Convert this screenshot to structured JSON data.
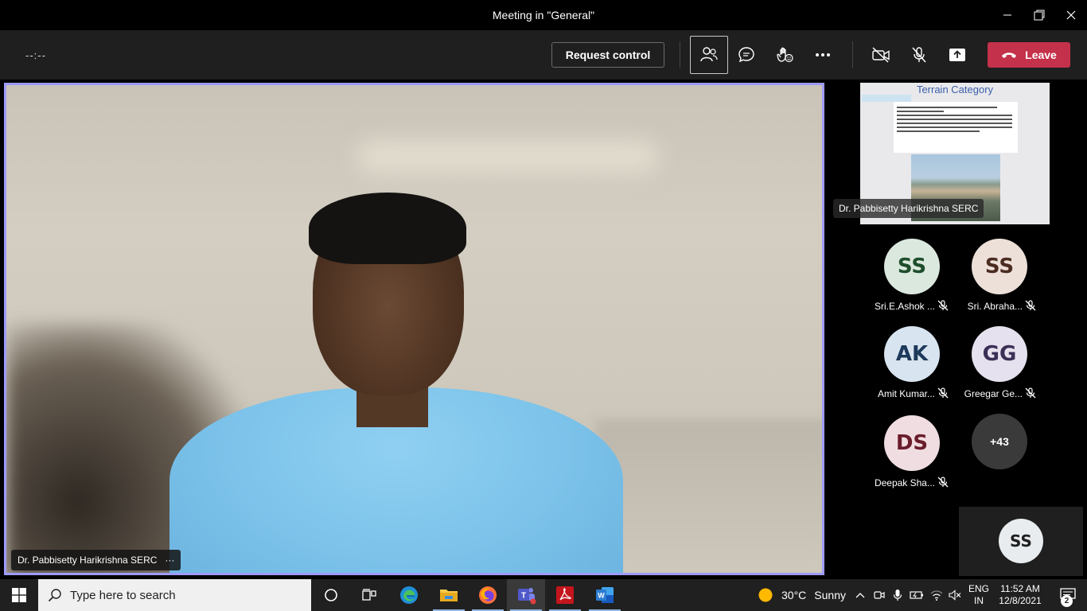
{
  "window": {
    "title": "Meeting in \"General\""
  },
  "toolbar": {
    "timer": "--:--",
    "request_control_label": "Request control",
    "leave_label": "Leave",
    "icons": [
      "participants-icon",
      "chat-icon",
      "raise-hand-icon",
      "more-options-icon",
      "camera-off-icon",
      "mic-off-icon",
      "share-tray-icon",
      "phone-hangup-icon"
    ]
  },
  "main_video": {
    "participant_name": "Dr. Pabbisetty Harikrishna SERC",
    "more_label": "···"
  },
  "shared_content": {
    "slide_title": "Terrain Category",
    "presenter_name": "Dr. Pabbisetty Harikrishna SERC"
  },
  "participants": [
    {
      "initials": "SS",
      "name": "Sri.E.Ashok ...",
      "muted": true,
      "bg": "#dbe8de",
      "fg": "#1e4d2b"
    },
    {
      "initials": "SS",
      "name": "Sri. Abraha...",
      "muted": true,
      "bg": "#ece0d9",
      "fg": "#4b2c20"
    },
    {
      "initials": "AK",
      "name": "Amit Kumar...",
      "muted": true,
      "bg": "#d8e4f0",
      "fg": "#1d3a5b"
    },
    {
      "initials": "GG",
      "name": "Greegar Ge...",
      "muted": true,
      "bg": "#e6e1ee",
      "fg": "#3b2f57"
    },
    {
      "initials": "DS",
      "name": "Deepak Sha...",
      "muted": true,
      "bg": "#f0dde1",
      "fg": "#6a1d2c"
    }
  ],
  "overflow_count": "+43",
  "self_view": {
    "initials": "SS"
  },
  "taskbar": {
    "search_placeholder": "Type here to search",
    "apps": [
      "cortana-icon",
      "task-view-icon",
      "edge-icon",
      "file-explorer-icon",
      "firefox-icon",
      "teams-icon",
      "acrobat-icon",
      "word-icon"
    ],
    "weather_temp": "30°C",
    "weather_desc": "Sunny",
    "lang_line1": "ENG",
    "lang_line2": "IN",
    "time": "11:52 AM",
    "date": "12/8/2021",
    "notification_count": "2"
  },
  "colors": {
    "accent_border": "#9e9bff",
    "leave_red": "#c4314b",
    "toolbar_bg": "#1f1f1f"
  }
}
